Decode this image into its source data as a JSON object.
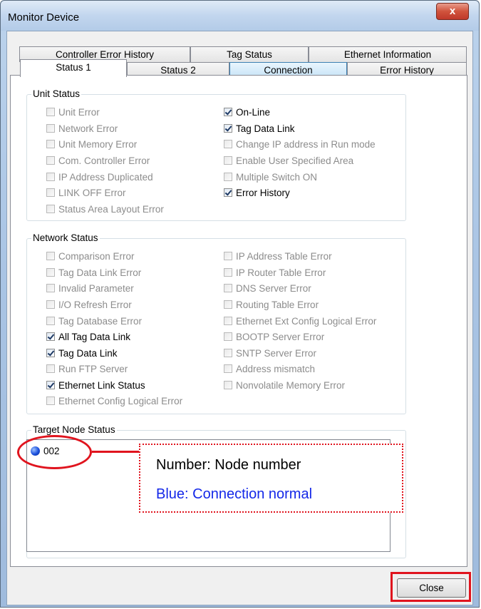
{
  "window": {
    "title": "Monitor Device",
    "close_glyph": "x"
  },
  "tabs": {
    "row1": [
      "Controller Error History",
      "Tag Status",
      "Ethernet Information"
    ],
    "row2": [
      "Status 1",
      "Status 2",
      "Connection",
      "Error History"
    ],
    "active": "Status 1"
  },
  "unit_status": {
    "title": "Unit Status",
    "items": [
      {
        "label": "Unit Error",
        "checked": false
      },
      {
        "label": "Network Error",
        "checked": false
      },
      {
        "label": "Unit Memory Error",
        "checked": false
      },
      {
        "label": "Com. Controller Error",
        "checked": false
      },
      {
        "label": "IP Address Duplicated",
        "checked": false
      },
      {
        "label": "LINK OFF Error",
        "checked": false
      },
      {
        "label": "Status Area Layout Error",
        "checked": false
      },
      {
        "label": "On-Line",
        "checked": true
      },
      {
        "label": "Tag Data Link",
        "checked": true
      },
      {
        "label": "Change IP address in Run mode",
        "checked": false
      },
      {
        "label": "Enable User Specified Area",
        "checked": false
      },
      {
        "label": "Multiple Switch ON",
        "checked": false
      },
      {
        "label": "Error History",
        "checked": true
      }
    ]
  },
  "network_status": {
    "title": "Network Status",
    "items": [
      {
        "label": "Comparison Error",
        "checked": false
      },
      {
        "label": "Tag Data Link Error",
        "checked": false
      },
      {
        "label": "Invalid Parameter",
        "checked": false
      },
      {
        "label": "I/O Refresh Error",
        "checked": false
      },
      {
        "label": "Tag Database Error",
        "checked": false
      },
      {
        "label": "All Tag Data Link",
        "checked": true
      },
      {
        "label": "Tag Data Link",
        "checked": true
      },
      {
        "label": "Run FTP Server",
        "checked": false
      },
      {
        "label": "Ethernet Link Status",
        "checked": true
      },
      {
        "label": "Ethernet Config Logical Error",
        "checked": false
      },
      {
        "label": "IP Address Table Error",
        "checked": false
      },
      {
        "label": "IP Router Table Error",
        "checked": false
      },
      {
        "label": "DNS Server Error",
        "checked": false
      },
      {
        "label": "Routing Table Error",
        "checked": false
      },
      {
        "label": "Ethernet Ext Config Logical Error",
        "checked": false
      },
      {
        "label": "BOOTP Server Error",
        "checked": false
      },
      {
        "label": "SNTP Server Error",
        "checked": false
      },
      {
        "label": "Address mismatch",
        "checked": false
      },
      {
        "label": "Nonvolatile Memory Error",
        "checked": false
      }
    ]
  },
  "target_node_status": {
    "title": "Target Node Status",
    "nodes": [
      {
        "number": "002",
        "color": "#1a4fdc"
      }
    ]
  },
  "callout": {
    "line1": "Number: Node number",
    "line2": "Blue: Connection normal",
    "line2_color": "#1428e8",
    "highlight_color": "#e0141e"
  },
  "buttons": {
    "close_label": "Close"
  }
}
